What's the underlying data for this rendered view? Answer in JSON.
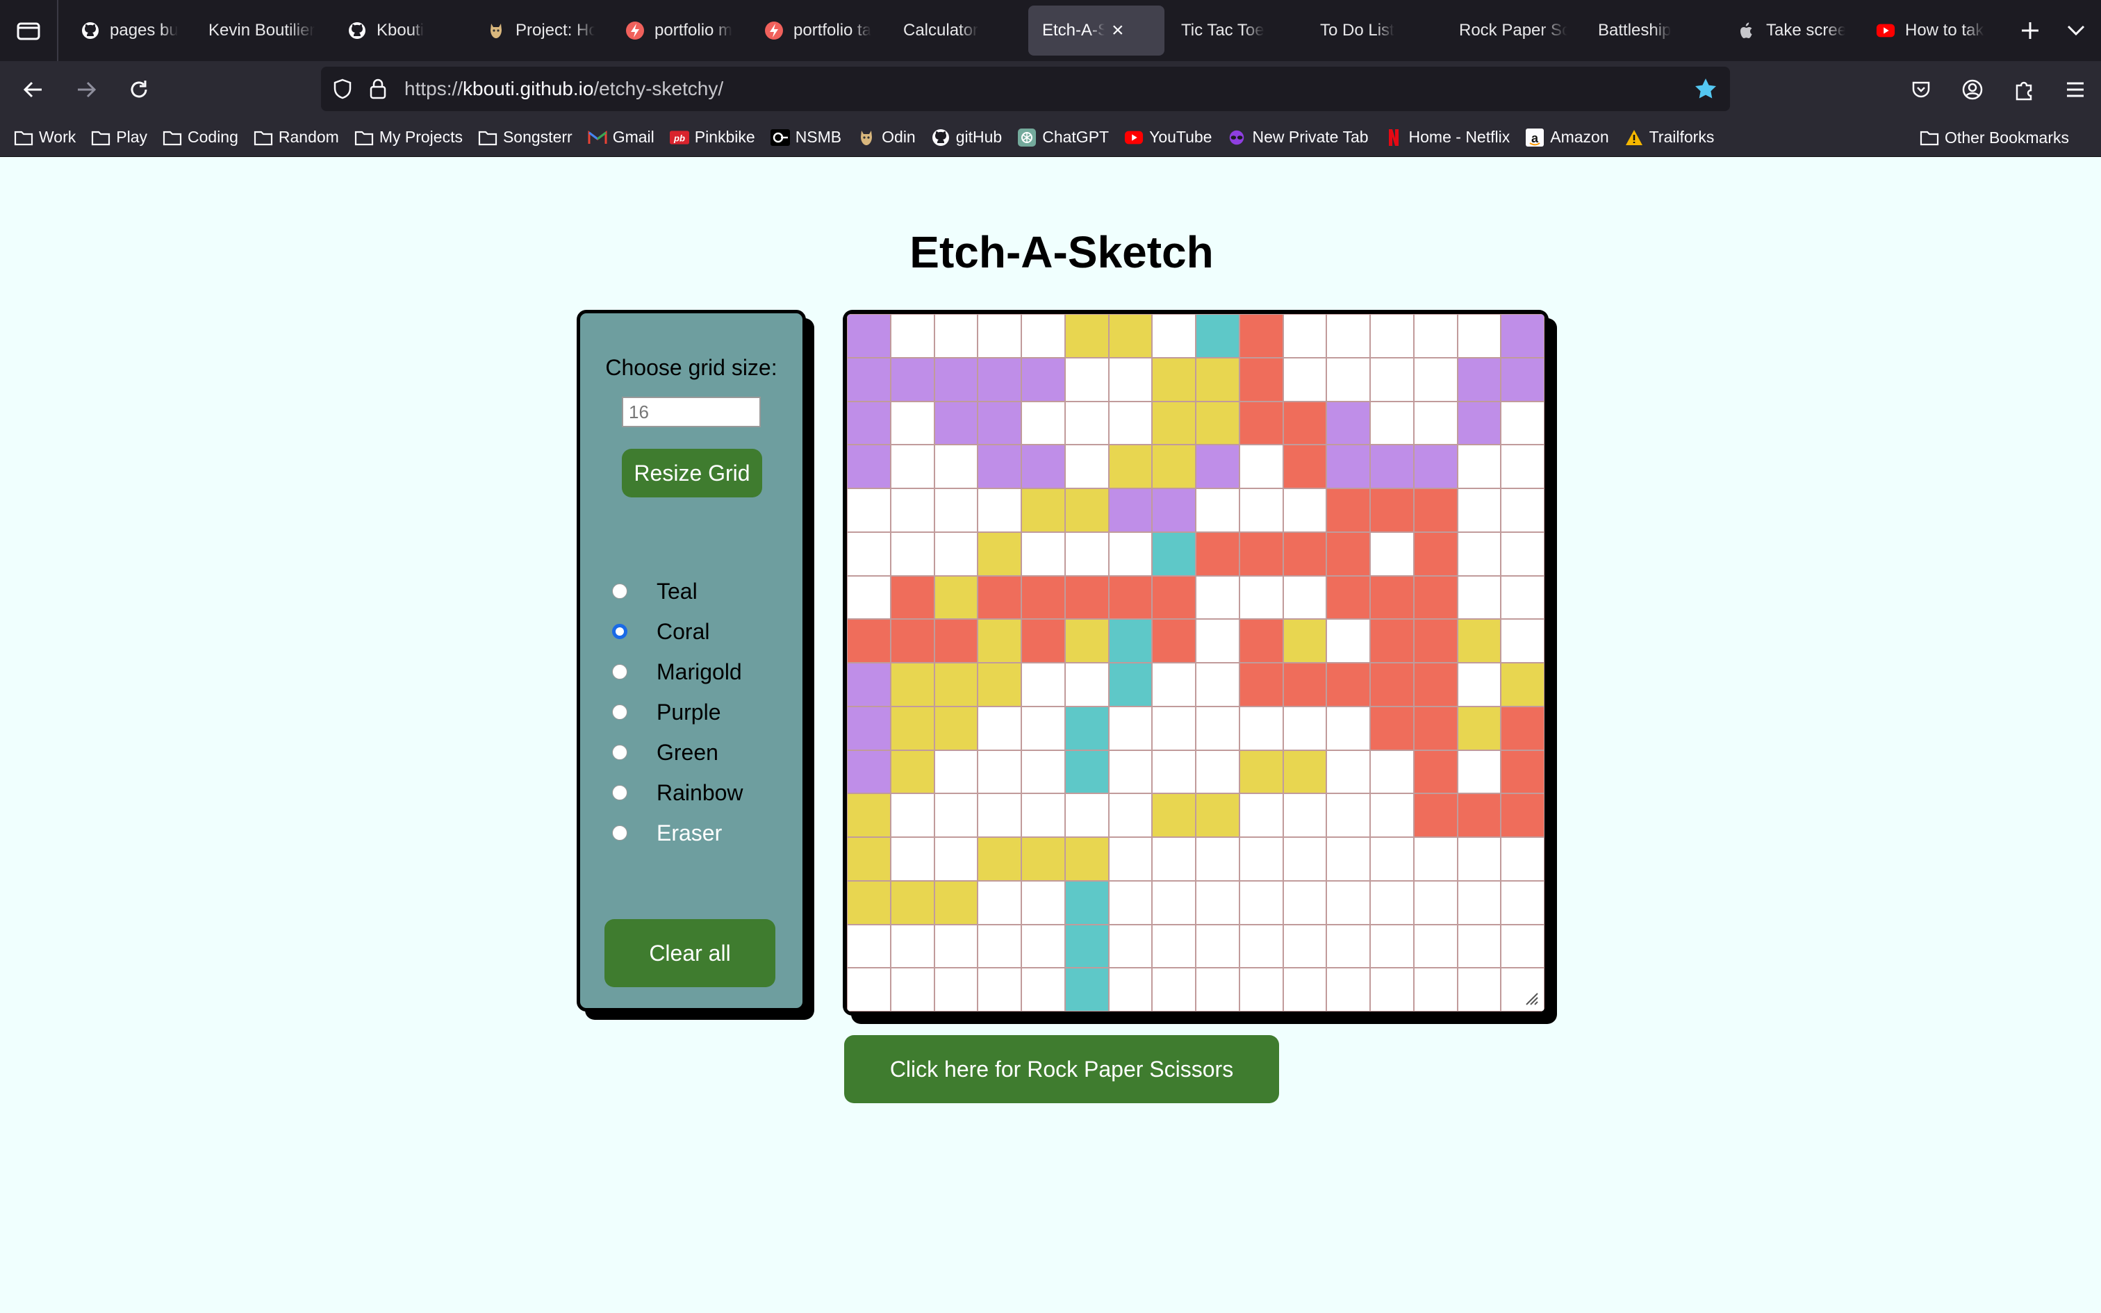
{
  "browser": {
    "tabs": [
      {
        "title": "pages buil",
        "icon": "github-icon",
        "width": 168
      },
      {
        "title": "Kevin Boutilier",
        "icon": "",
        "width": 196
      },
      {
        "title": "Kbouti",
        "icon": "github-icon",
        "width": 196
      },
      {
        "title": "Project: Ho",
        "icon": "odin-icon",
        "width": 196
      },
      {
        "title": "portfolio m",
        "icon": "lightning-icon",
        "width": 196
      },
      {
        "title": "portfolio ta",
        "icon": "lightning-icon",
        "width": 196
      },
      {
        "title": "Calculator",
        "icon": "",
        "width": 196
      },
      {
        "title": "Etch-A-Sketch",
        "icon": "",
        "width": 196,
        "active": true
      },
      {
        "title": "Tic Tac Toe",
        "icon": "",
        "width": 196
      },
      {
        "title": "To Do List",
        "icon": "",
        "width": 196
      },
      {
        "title": "Rock Paper Sc",
        "icon": "",
        "width": 196
      },
      {
        "title": "Battleship",
        "icon": "",
        "width": 196
      },
      {
        "title": "Take scree",
        "icon": "apple-icon",
        "width": 196
      },
      {
        "title": "How to take",
        "icon": "youtube-icon",
        "width": 196
      }
    ],
    "url": {
      "scheme": "https://",
      "host": "kbouti.github.io",
      "path": "/etchy-sketchy/"
    },
    "bookmarks": [
      {
        "label": "Work",
        "icon": "folder-icon"
      },
      {
        "label": "Play",
        "icon": "folder-icon"
      },
      {
        "label": "Coding",
        "icon": "folder-icon"
      },
      {
        "label": "Random",
        "icon": "folder-icon"
      },
      {
        "label": "My Projects",
        "icon": "folder-icon"
      },
      {
        "label": "Songsterr",
        "icon": "folder-icon"
      },
      {
        "label": "Gmail",
        "icon": "gmail-icon"
      },
      {
        "label": "Pinkbike",
        "icon": "pinkbike-icon"
      },
      {
        "label": "NSMB",
        "icon": "nsmb-icon"
      },
      {
        "label": "Odin",
        "icon": "odin-icon"
      },
      {
        "label": "gitHub",
        "icon": "github-icon"
      },
      {
        "label": "ChatGPT",
        "icon": "chatgpt-icon"
      },
      {
        "label": "YouTube",
        "icon": "youtube-icon"
      },
      {
        "label": "New Private Tab",
        "icon": "private-icon"
      },
      {
        "label": "Home - Netflix",
        "icon": "netflix-icon"
      },
      {
        "label": "Amazon",
        "icon": "amazon-icon"
      },
      {
        "label": "Trailforks",
        "icon": "trailforks-icon"
      }
    ],
    "other_bookmarks": "Other Bookmarks"
  },
  "page": {
    "title": "Etch-A-Sketch",
    "grid_size_label": "Choose grid size:",
    "grid_size_value": "16",
    "resize_button": "Resize Grid",
    "color_options": [
      "Teal",
      "Coral",
      "Marigold",
      "Purple",
      "Green",
      "Rainbow",
      "Eraser"
    ],
    "selected_color": "Coral",
    "clear_button": "Clear all",
    "rps_link": "Click here for Rock Paper Scissors"
  },
  "colors": {
    "W": "#ffffff",
    "P": "#bf8ee8",
    "Y": "#e8d650",
    "T": "#5ec8c8",
    "C": "#ef6d5b",
    "button_green": "#3f7c2f",
    "panel_teal": "#6e9e9f",
    "page_bg": "#f0fffe"
  },
  "grid": [
    "PWWWWYYWTCWWWWWP",
    "PPPPPWWYYCWWWWPP",
    "PWPPWWWYYCCPWWPW",
    "PWWPPWYYPWCPPPWW",
    "WWWWYYPPWWWCCCWW",
    "WWWYWWWTCCCCWCWW",
    "WCYCCCCCWWWCCCWW",
    "CCCYCYTCWCYWCCYW",
    "PYYYWWTWWCCCCCWY",
    "PYYWWTWWWWWWCCYC",
    "PYWWWTWWWYYWWCWC",
    "YWWWWWWYYWWWWCCC",
    "YWWYYYWWWWWWWWWW",
    "YYYWWTWWWWWWWWWW",
    "WWWWWTWWWWWWWWWW",
    "WWWWWTWWWWWWWWWW"
  ]
}
